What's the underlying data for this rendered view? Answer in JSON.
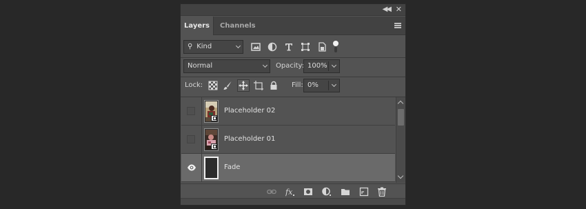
{
  "tabs": [
    {
      "label": "Layers",
      "active": true
    },
    {
      "label": "Channels",
      "active": false
    }
  ],
  "filter": {
    "label": "Kind"
  },
  "filter_icons": [
    "image-filter-icon",
    "adjustment-filter-icon",
    "type-filter-icon",
    "shape-filter-icon",
    "smart-object-filter-icon",
    "filter-toggle-icon"
  ],
  "blend_mode": {
    "value": "Normal"
  },
  "opacity": {
    "label": "Opacity:",
    "value": "100%"
  },
  "lock": {
    "label": "Lock:"
  },
  "lock_icons": [
    "lock-transparent-icon",
    "lock-image-icon",
    "lock-position-icon",
    "lock-artboard-icon",
    "lock-all-icon"
  ],
  "fill": {
    "label": "Fill:",
    "value": "0%"
  },
  "layers": [
    {
      "name": "Placeholder 02",
      "visible": false,
      "selected": false
    },
    {
      "name": "Placeholder 01",
      "visible": false,
      "selected": false
    },
    {
      "name": "Fade",
      "visible": true,
      "selected": true
    }
  ],
  "footer_icons": [
    "link-layers-icon",
    "fx-icon",
    "add-mask-icon",
    "new-adjustment-icon",
    "new-group-icon",
    "new-layer-icon",
    "trash-icon"
  ],
  "colors": {
    "panel": "#535353",
    "selected_row": "#6a6a6a",
    "background": "#282828"
  }
}
